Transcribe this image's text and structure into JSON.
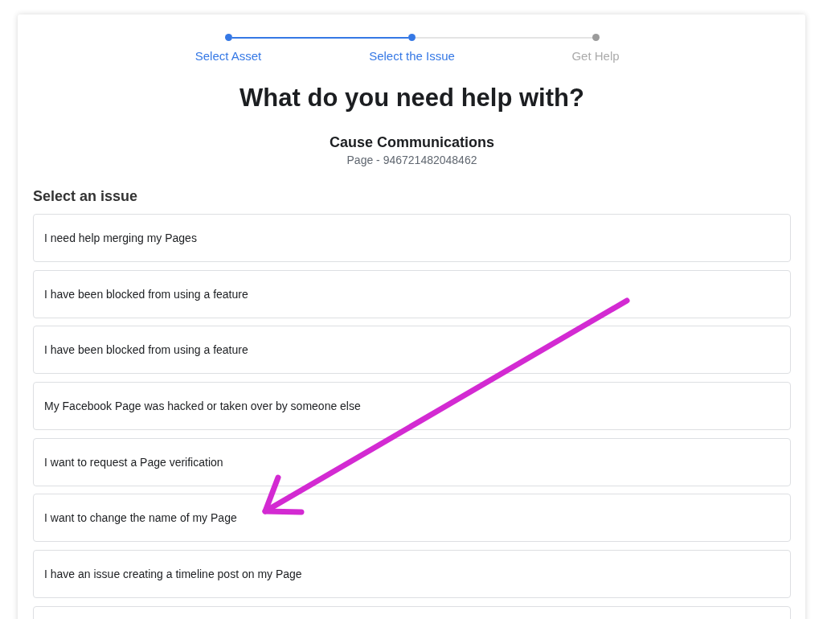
{
  "stepper": {
    "steps": [
      {
        "label": "Select Asset",
        "reached": true
      },
      {
        "label": "Select the Issue",
        "reached": true
      },
      {
        "label": "Get Help",
        "reached": false
      }
    ]
  },
  "heading": "What do you need help with?",
  "asset": {
    "name": "Cause Communications",
    "detail": "Page - 946721482048462"
  },
  "issues": {
    "title": "Select an issue",
    "options": [
      {
        "kind": "option",
        "label": "I need help merging my Pages"
      },
      {
        "kind": "option",
        "label": "I have been blocked from using a feature"
      },
      {
        "kind": "option",
        "label": "I have been blocked from using a feature"
      },
      {
        "kind": "option",
        "label": "My Facebook Page was hacked or taken over by someone else"
      },
      {
        "kind": "option",
        "label": "I want to request a Page verification"
      },
      {
        "kind": "option",
        "label": "I want to change the name of my Page"
      },
      {
        "kind": "option",
        "label": "I have an issue creating a timeline post on my Page"
      },
      {
        "kind": "partial"
      }
    ]
  }
}
